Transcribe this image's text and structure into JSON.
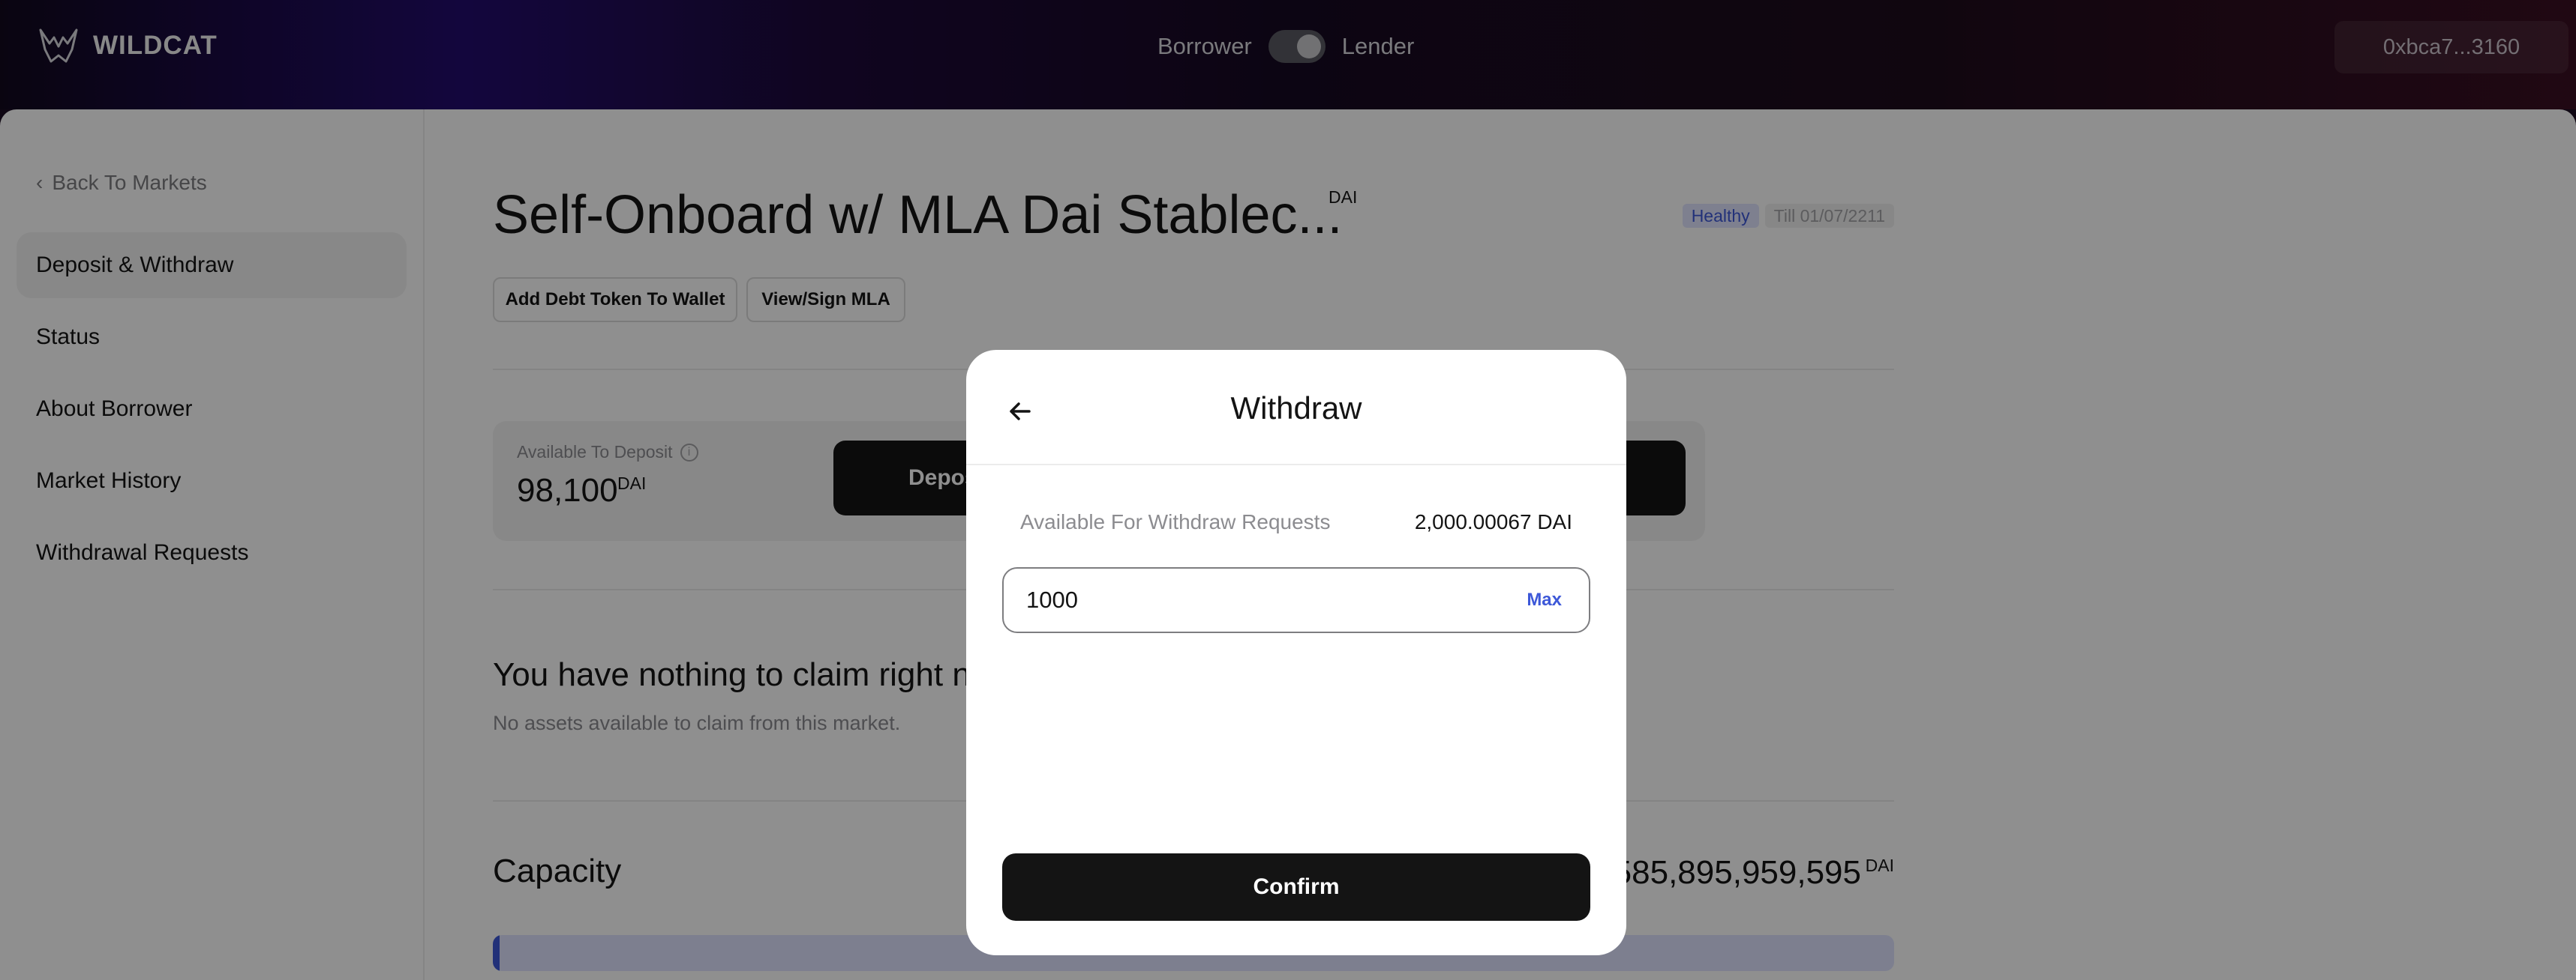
{
  "header": {
    "logo_text": "WILDCAT",
    "role_left": "Borrower",
    "role_right": "Lender",
    "wallet": "0xbca7...3160"
  },
  "sidebar": {
    "back_label": "Back To Markets",
    "items": [
      {
        "label": "Deposit & Withdraw",
        "active": true
      },
      {
        "label": "Status"
      },
      {
        "label": "About Borrower"
      },
      {
        "label": "Market History"
      },
      {
        "label": "Withdrawal Requests"
      }
    ]
  },
  "market": {
    "title": "Self-Onboard w/ MLA Dai Stablec...",
    "token": "DAI",
    "badge_status": "Healthy",
    "badge_till": "Till 01/07/2211",
    "add_token_label": "Add Debt Token To Wallet",
    "view_mla_label": "View/Sign MLA"
  },
  "deposit": {
    "available_label": "Available To Deposit",
    "available_value": "98,100",
    "available_unit": "DAI",
    "button_label": "Deposit"
  },
  "claim": {
    "title": "You have nothing to claim right now",
    "subtitle": "No assets available to claim from this market."
  },
  "capacity": {
    "title": "Capacity",
    "value": "585,895,959,595",
    "unit": "DAI",
    "progress_fraction": 0.005
  },
  "modal": {
    "title": "Withdraw",
    "available_label": "Available For Withdraw Requests",
    "available_value": "2,000.00067 DAI",
    "amount_value": "1000",
    "max_label": "Max",
    "confirm_label": "Confirm"
  },
  "colors": {
    "accent": "#3d58d8",
    "button_dark": "#141414"
  }
}
